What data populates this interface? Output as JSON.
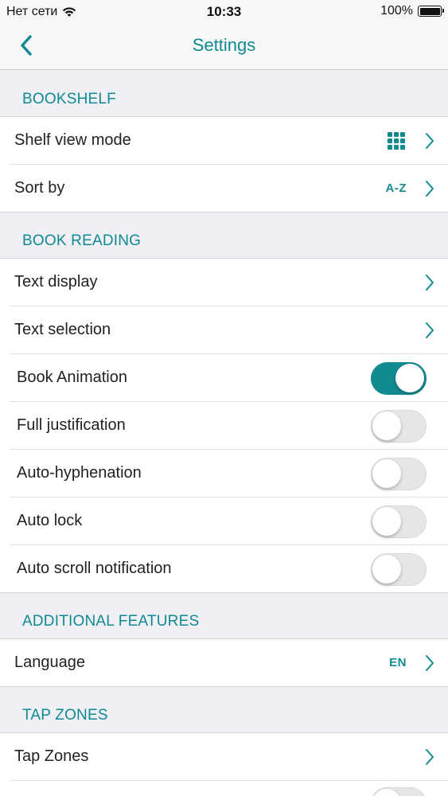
{
  "status_bar": {
    "carrier": "Нет сети",
    "time": "10:33",
    "battery": "100%"
  },
  "nav": {
    "title": "Settings",
    "back_icon": "chevron-left-icon"
  },
  "sections": {
    "bookshelf": {
      "header": "BOOKSHELF",
      "shelf_view_mode": {
        "label": "Shelf view mode",
        "icon": "grid-icon"
      },
      "sort_by": {
        "label": "Sort by",
        "value": "A-Z"
      }
    },
    "book_reading": {
      "header": "BOOK READING",
      "text_display": {
        "label": "Text display"
      },
      "text_selection": {
        "label": "Text selection"
      },
      "book_animation": {
        "label": "Book Animation",
        "on": true
      },
      "full_justification": {
        "label": "Full justification",
        "on": false
      },
      "auto_hyphenation": {
        "label": "Auto-hyphenation",
        "on": false
      },
      "auto_lock": {
        "label": "Auto lock",
        "on": false
      },
      "auto_scroll_notification": {
        "label": "Auto scroll notification",
        "on": false
      }
    },
    "additional_features": {
      "header": "ADDITIONAL FEATURES",
      "language": {
        "label": "Language",
        "value": "EN"
      }
    },
    "tap_zones": {
      "header": "TAP ZONES",
      "tap_zones": {
        "label": "Tap Zones"
      },
      "partial_row": {
        "on": false
      }
    }
  },
  "colors": {
    "accent": "#108a92",
    "background": "#efeff4",
    "row": "#ffffff",
    "toggle_off": "#e6e6e6"
  }
}
